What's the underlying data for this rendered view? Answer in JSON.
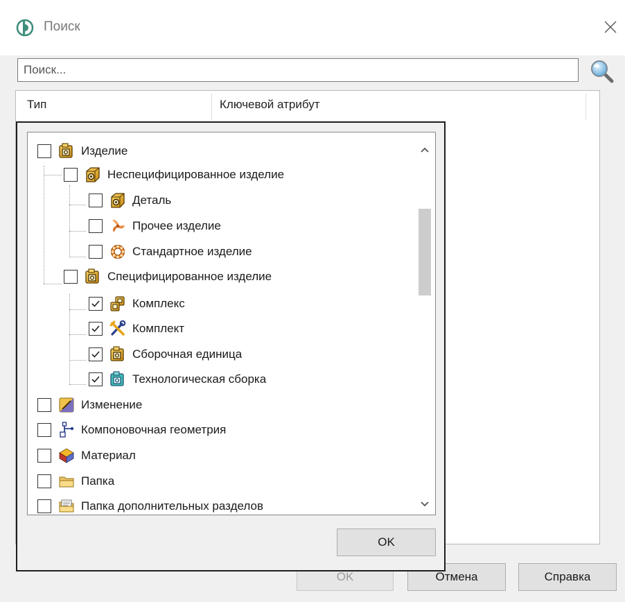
{
  "window": {
    "title": "Поиск"
  },
  "search": {
    "placeholder": "Поиск..."
  },
  "results": {
    "columns": [
      "Тип",
      "Ключевой атрибут"
    ]
  },
  "dialog_buttons": {
    "ok": "OK",
    "cancel": "Отмена",
    "help": "Справка"
  },
  "popup": {
    "ok": "OK",
    "tree": [
      {
        "label": "Изделие",
        "checked": false,
        "icon": "product-icon"
      },
      {
        "label": "Неспецифицированное изделие",
        "checked": false,
        "icon": "unspecified-product-icon"
      },
      {
        "label": "Деталь",
        "checked": false,
        "icon": "part-icon"
      },
      {
        "label": "Прочее изделие",
        "checked": false,
        "icon": "other-product-icon"
      },
      {
        "label": "Стандартное изделие",
        "checked": false,
        "icon": "standard-product-icon"
      },
      {
        "label": "Специфицированное изделие",
        "checked": false,
        "icon": "specified-product-icon"
      },
      {
        "label": "Комплекс",
        "checked": true,
        "icon": "complex-icon"
      },
      {
        "label": "Комплект",
        "checked": true,
        "icon": "kit-icon"
      },
      {
        "label": "Сборочная единица",
        "checked": true,
        "icon": "assembly-unit-icon"
      },
      {
        "label": "Технологическая сборка",
        "checked": true,
        "icon": "technological-assembly-icon"
      },
      {
        "label": "Изменение",
        "checked": false,
        "icon": "change-icon"
      },
      {
        "label": "Компоновочная геометрия",
        "checked": false,
        "icon": "layout-geometry-icon"
      },
      {
        "label": "Материал",
        "checked": false,
        "icon": "material-icon"
      },
      {
        "label": "Папка",
        "checked": false,
        "icon": "folder-icon"
      },
      {
        "label": "Папка дополнительных разделов",
        "checked": false,
        "icon": "additional-sections-folder-icon"
      }
    ]
  }
}
